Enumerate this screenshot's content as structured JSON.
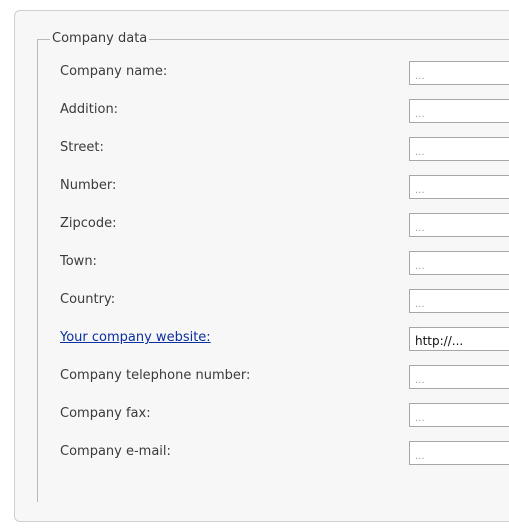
{
  "group": {
    "legend": "Company data"
  },
  "fields": [
    {
      "label": "Company name:",
      "value": "..."
    },
    {
      "label": "Addition:",
      "value": "..."
    },
    {
      "label": "Street:",
      "value": "..."
    },
    {
      "label": "Number:",
      "value": "..."
    },
    {
      "label": "Zipcode:",
      "value": "..."
    },
    {
      "label": "Town:",
      "value": "..."
    },
    {
      "label": "Country:",
      "value": "..."
    },
    {
      "label": "Your company website:",
      "value": "http://..."
    },
    {
      "label": "Company telephone number:",
      "value": "..."
    },
    {
      "label": "Company fax:",
      "value": "..."
    },
    {
      "label": "Company e-mail:",
      "value": "..."
    }
  ]
}
